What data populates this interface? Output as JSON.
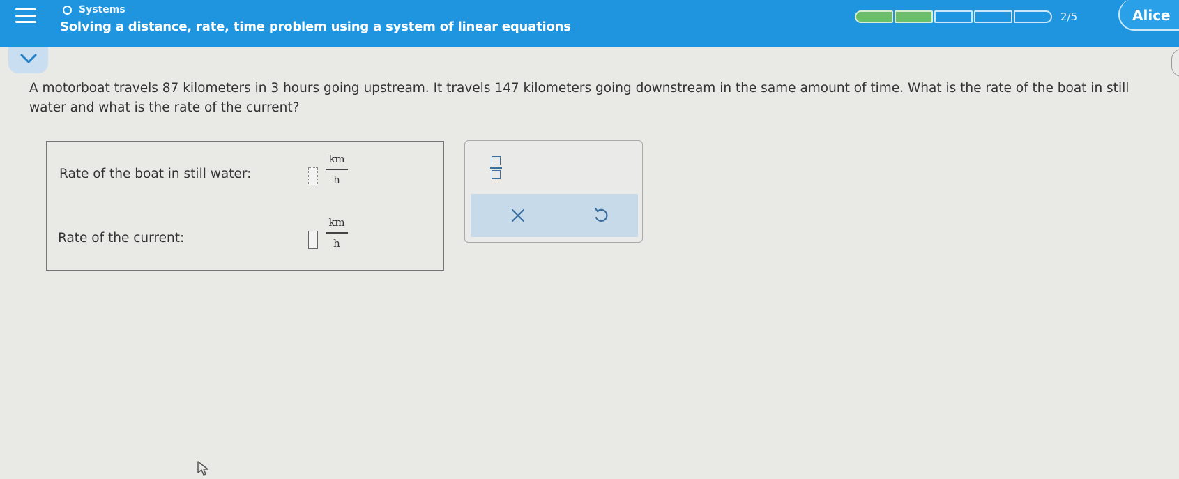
{
  "header": {
    "topic": "Systems",
    "title": "Solving a distance, rate, time problem using a system of linear equations",
    "progress": {
      "completed": 2,
      "total": 5,
      "label": "2/5"
    },
    "user_name": "Alice"
  },
  "question": {
    "text": "A motorboat travels 87 kilometers in 3 hours going upstream. It travels 147 kilometers going downstream in the same amount of time. What is the rate of the boat in still water and what is the rate of the current?"
  },
  "answers": {
    "rows": [
      {
        "label": "Rate of the boat in still water:",
        "value": "",
        "unit_num": "km",
        "unit_den": "h"
      },
      {
        "label": "Rate of the current:",
        "value": "",
        "unit_num": "km",
        "unit_den": "h"
      }
    ]
  },
  "tools": {
    "fraction": "fraction-icon",
    "clear": "close-icon",
    "undo": "undo-icon"
  },
  "colors": {
    "header": "#1f95e0",
    "progress_done": "#6cbf6a",
    "background": "#e9e9e6",
    "tool_bar": "#c6daea"
  }
}
